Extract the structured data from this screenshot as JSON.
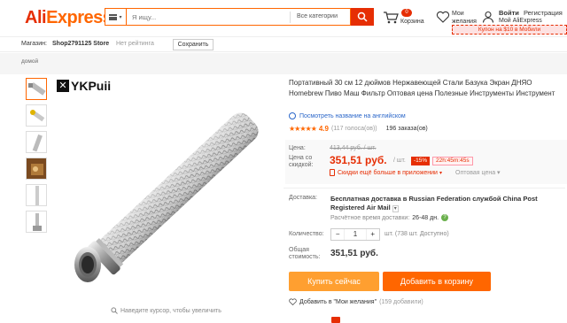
{
  "header": {
    "logo_part1": "Ali",
    "logo_part2": "Express",
    "search_placeholder": "Я ищу...",
    "search_category": "Все категории",
    "cart_count": "0",
    "cart_label": "Корзина",
    "wishlist_label": "Мои желания",
    "login_label": "Войти",
    "register_label": "Регистрация",
    "my_account_label": "Мой AliExpress",
    "coupon_text": "Купон на $10 в Мобили"
  },
  "storebar": {
    "store_label": "Магазин:",
    "store_name": "Shop2791125 Store",
    "rating_label": "Нет рейтинга",
    "save_button": "Сохранить"
  },
  "breadcrumb": {
    "home": "домой"
  },
  "gallery": {
    "brand": "YKPuii",
    "zoom_hint": "Наведите курсор, чтобы увеличить"
  },
  "product": {
    "title": "Портативный 30 см 12 дюймов Нержавеющей Стали Базука Экран ДНЯО Homebrew Пиво Маш Фильтр Оптовая цена Полезные Инструменты Инструмент",
    "translate_link": "Посмотреть название на английском",
    "rating_score": "4.9",
    "rating_stars": "★★★★★",
    "reviews": "(117 голоса(ов))",
    "orders": "196 заказа(ов)",
    "price_label": "Цена:",
    "old_price": "413,44 руб. / шт.",
    "discount_price_label": "Цена со скидкой:",
    "new_price": "351,51 руб.",
    "unit": "/ шт.",
    "discount_badge": "-15%",
    "timer": "22h:45m:45s",
    "app_deal": "Скидки ещё больше в приложении",
    "wholesale": "Оптовая цена",
    "shipping_label": "Доставка:",
    "shipping_text": "Бесплатная доставка в Russian Federation службой China Post Registered Air Mail",
    "eta_label": "Расчётное время доставки:",
    "eta_value": "26-48 дн.",
    "qty_label": "Количество:",
    "qty_value": "1",
    "qty_available": "шт. (738 шт. Доступно)",
    "total_label": "Общая стоимость:",
    "total_value": "351,51 руб.",
    "buy_now": "Купить сейчас",
    "add_to_cart": "Добавить в корзину",
    "add_wishlist": "Добавить в \"Мои желания\"",
    "wishlist_count": "(159 добавили)"
  },
  "colors": {
    "accent": "#e62e04",
    "orange": "#ff6600",
    "buy_now": "#ff9f30"
  }
}
